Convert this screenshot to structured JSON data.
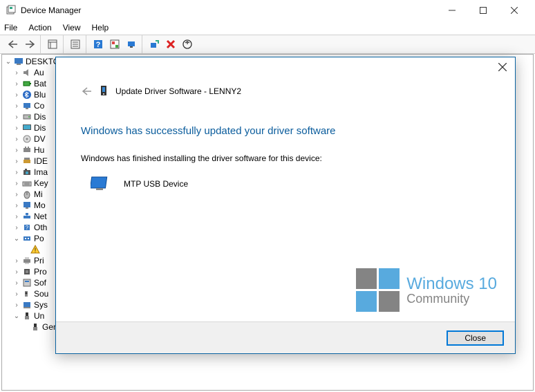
{
  "window": {
    "title": "Device Manager"
  },
  "menu": {
    "file": "File",
    "action": "Action",
    "view": "View",
    "help": "Help"
  },
  "tree": {
    "root": "DESKTO",
    "items": [
      "Au",
      "Bat",
      "Blu",
      "Co",
      "Dis",
      "Dis",
      "DV",
      "Hu",
      "IDE",
      "Ima",
      "Key",
      "Mi",
      "Mo",
      "Net",
      "Oth"
    ],
    "port_label": "Po",
    "printer": "Pri",
    "processor": "Pro",
    "software": "Sof",
    "sound": "Sou",
    "system": "Sys",
    "usb": "Un",
    "generic_hub": "Generic USB Hub"
  },
  "dialog": {
    "header": "Update Driver Software - LENNY2",
    "heading": "Windows has successfully updated your driver software",
    "body": "Windows has finished installing the driver software for this device:",
    "device": "MTP USB Device",
    "close": "Close"
  },
  "watermark": {
    "line1": "Windows 10",
    "line2": "Community"
  }
}
